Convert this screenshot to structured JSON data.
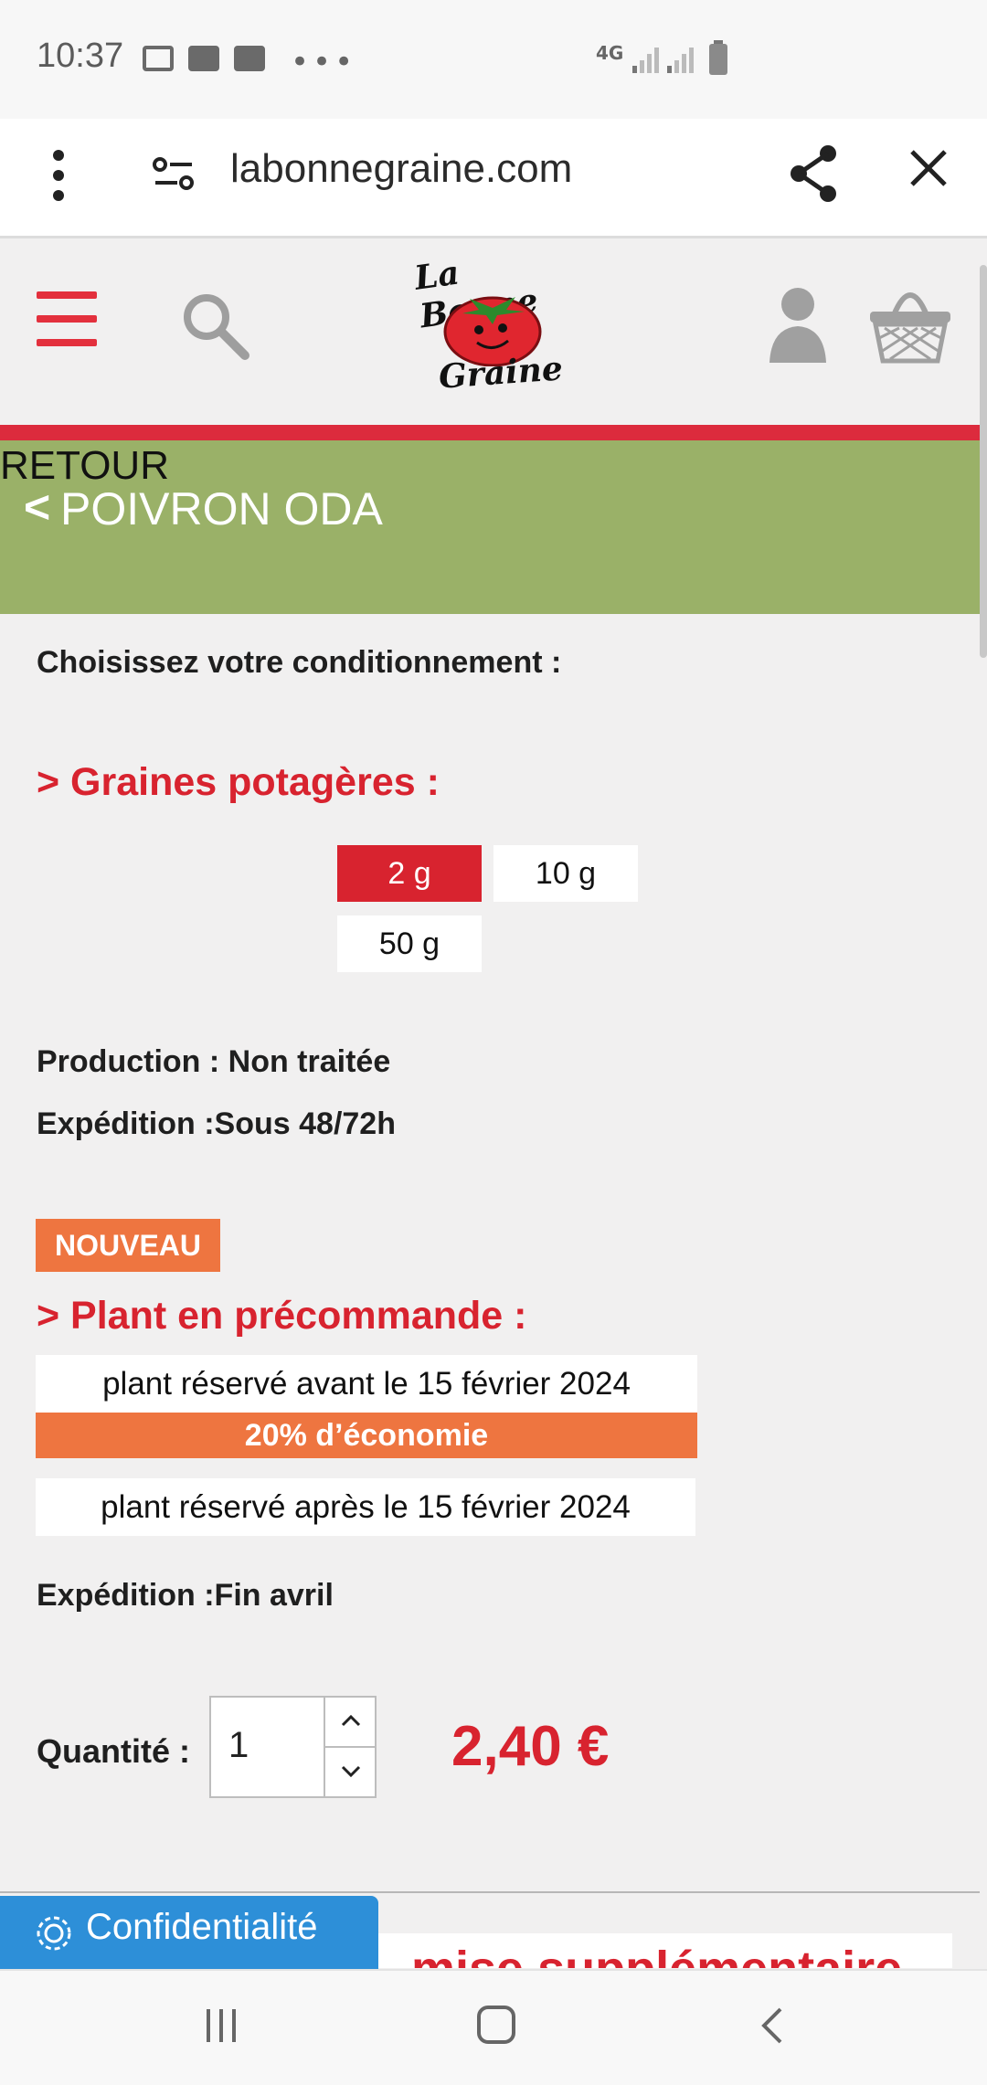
{
  "status_bar": {
    "time": "10:37",
    "network": "4G"
  },
  "browser": {
    "url": "labonnegraine.com"
  },
  "site": {
    "logo_top": "La Bonne",
    "logo_bottom": "Graine"
  },
  "breadcrumb": {
    "back_label": "RETOUR",
    "chevron": "<",
    "product_title": "POIVRON ODA"
  },
  "packaging": {
    "heading": "Choisissez votre conditionnement :",
    "seeds_heading": "> Graines potagères :",
    "options": [
      {
        "label": "2 g",
        "selected": true
      },
      {
        "label": "10 g",
        "selected": false
      },
      {
        "label": "50 g",
        "selected": false
      }
    ],
    "production": "Production : Non traitée",
    "shipping": "Expédition :Sous 48/72h"
  },
  "preorder": {
    "badge": "NOUVEAU",
    "heading": "> Plant en précommande :",
    "option_before": "plant réservé avant le 15 février 2024",
    "discount": "20% d’économie",
    "option_after": "plant réservé après le 15 février 2024",
    "shipping": "Expédition :Fin avril"
  },
  "purchase": {
    "quantity_label": "Quantité :",
    "quantity_value": "1",
    "price": "2,40 €"
  },
  "below_fold_text": "mise supplémentaire",
  "privacy_button": "Confidentialité",
  "colors": {
    "accent_red": "#d8232f",
    "band_green": "#9ab168",
    "badge_orange": "#ee7540",
    "privacy_blue": "#2d8fd8"
  }
}
